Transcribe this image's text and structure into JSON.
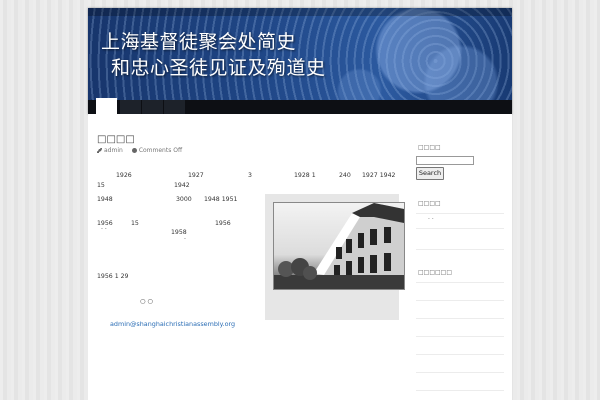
{
  "header": {
    "title_line1": "上海基督徒聚会处简史",
    "title_line2": "和忠心圣徒见证及殉道史"
  },
  "post": {
    "title": "□□□□",
    "author": "admin",
    "comments": "Comments Off",
    "lines": [
      {
        "id": "l1a",
        "text": "1926"
      },
      {
        "id": "l1b",
        "text": "1927"
      },
      {
        "id": "l1c",
        "text": "3"
      },
      {
        "id": "l1d",
        "text": "1928 1"
      },
      {
        "id": "l1e",
        "text": "240"
      },
      {
        "id": "l1f",
        "text": "1927  1942"
      },
      {
        "id": "l2a",
        "text": "15"
      },
      {
        "id": "l2b",
        "text": "1942"
      },
      {
        "id": "l3a",
        "text": "1948"
      },
      {
        "id": "l3b",
        "text": "3000"
      },
      {
        "id": "l3c",
        "text": "1948  1951"
      },
      {
        "id": "l4a",
        "text": "1956"
      },
      {
        "id": "l4b",
        "text": "15"
      },
      {
        "id": "l4c",
        "text": "1956"
      },
      {
        "id": "l4d",
        "text": "·   ·"
      },
      {
        "id": "l5a",
        "text": "1958"
      },
      {
        "id": "l5b",
        "text": "·"
      },
      {
        "id": "l6a",
        "text": "1956 1 29"
      },
      {
        "id": "l7a",
        "text": "○ ○"
      }
    ],
    "email": "admin@shanghaichristianassembly.org"
  },
  "sidebar": {
    "search_heading": "□□□□",
    "search_button": "Search",
    "section2_heading": "□□□□",
    "section2_item": "·  ·",
    "section3_heading": "□□□□□□"
  }
}
